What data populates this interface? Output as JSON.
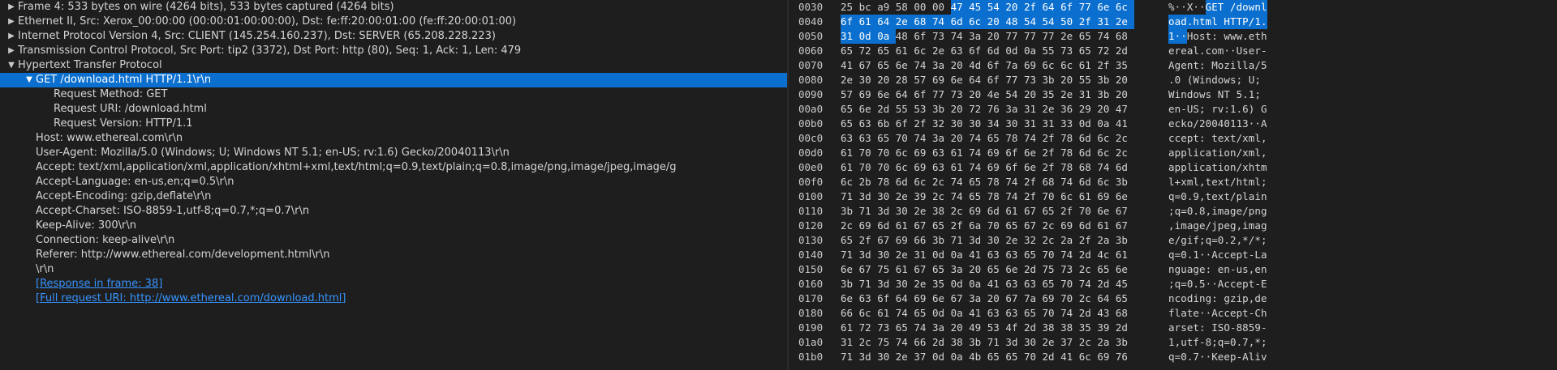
{
  "tree": [
    {
      "expander": "▶",
      "text": "Frame 4: 533 bytes on wire (4264 bits), 533 bytes captured (4264 bits)",
      "depth": 0
    },
    {
      "expander": "▶",
      "text": "Ethernet II, Src: Xerox_00:00:00 (00:00:01:00:00:00), Dst: fe:ff:20:00:01:00 (fe:ff:20:00:01:00)",
      "depth": 0
    },
    {
      "expander": "▶",
      "text": "Internet Protocol Version 4, Src: CLIENT (145.254.160.237), Dst: SERVER (65.208.228.223)",
      "depth": 0
    },
    {
      "expander": "▶",
      "text": "Transmission Control Protocol, Src Port: tip2 (3372), Dst Port: http (80), Seq: 1, Ack: 1, Len: 479",
      "depth": 0
    },
    {
      "expander": "▼",
      "text": "Hypertext Transfer Protocol",
      "depth": 0
    },
    {
      "expander": "▼",
      "text": "GET /download.html HTTP/1.1\\r\\n",
      "depth": 1,
      "selected": true
    },
    {
      "expander": "",
      "text": "Request Method: GET",
      "depth": 2
    },
    {
      "expander": "",
      "text": "Request URI: /download.html",
      "depth": 2
    },
    {
      "expander": "",
      "text": "Request Version: HTTP/1.1",
      "depth": 2
    },
    {
      "expander": "",
      "text": "Host: www.ethereal.com\\r\\n",
      "depth": 1
    },
    {
      "expander": "",
      "text": "User-Agent: Mozilla/5.0 (Windows; U; Windows NT 5.1; en-US; rv:1.6) Gecko/20040113\\r\\n",
      "depth": 1
    },
    {
      "expander": "",
      "text": "Accept: text/xml,application/xml,application/xhtml+xml,text/html;q=0.9,text/plain;q=0.8,image/png,image/jpeg,image/g",
      "depth": 1
    },
    {
      "expander": "",
      "text": "Accept-Language: en-us,en;q=0.5\\r\\n",
      "depth": 1
    },
    {
      "expander": "",
      "text": "Accept-Encoding: gzip,deflate\\r\\n",
      "depth": 1
    },
    {
      "expander": "",
      "text": "Accept-Charset: ISO-8859-1,utf-8;q=0.7,*;q=0.7\\r\\n",
      "depth": 1
    },
    {
      "expander": "",
      "text": "Keep-Alive: 300\\r\\n",
      "depth": 1
    },
    {
      "expander": "",
      "text": "Connection: keep-alive\\r\\n",
      "depth": 1
    },
    {
      "expander": "",
      "text": "Referer: http://www.ethereal.com/development.html\\r\\n",
      "depth": 1
    },
    {
      "expander": "",
      "text": "\\r\\n",
      "depth": 1
    },
    {
      "expander": "",
      "text": "[Response in frame: 38]",
      "depth": 1,
      "link": true
    },
    {
      "expander": "",
      "text": "[Full request URI: http://www.ethereal.com/download.html]",
      "depth": 1,
      "link": true
    }
  ],
  "hexdump": [
    {
      "offset": "0030",
      "hex": [
        "25",
        "bc",
        "a9",
        "58",
        "00",
        "00",
        "47",
        "45",
        "54",
        "20",
        "2f",
        "64",
        "6f",
        "77",
        "6e",
        "6c"
      ],
      "ascii": [
        "%",
        "·",
        "·",
        "X",
        "·",
        "·",
        "G",
        "E",
        "T",
        " ",
        "/",
        "d",
        "o",
        "w",
        "n",
        "l"
      ],
      "hl_from": 6
    },
    {
      "offset": "0040",
      "hex": [
        "6f",
        "61",
        "64",
        "2e",
        "68",
        "74",
        "6d",
        "6c",
        "20",
        "48",
        "54",
        "54",
        "50",
        "2f",
        "31",
        "2e"
      ],
      "ascii": [
        "o",
        "a",
        "d",
        ".",
        "h",
        "t",
        "m",
        "l",
        " ",
        "H",
        "T",
        "T",
        "P",
        "/",
        "1",
        "."
      ],
      "hl_from": 0
    },
    {
      "offset": "0050",
      "hex": [
        "31",
        "0d",
        "0a",
        "48",
        "6f",
        "73",
        "74",
        "3a",
        "20",
        "77",
        "77",
        "77",
        "2e",
        "65",
        "74",
        "68"
      ],
      "ascii": [
        "1",
        "·",
        "·",
        "H",
        "o",
        "s",
        "t",
        ":",
        " ",
        "w",
        "w",
        "w",
        ".",
        "e",
        "t",
        "h"
      ],
      "hl_to": 3
    },
    {
      "offset": "0060",
      "hex": [
        "65",
        "72",
        "65",
        "61",
        "6c",
        "2e",
        "63",
        "6f",
        "6d",
        "0d",
        "0a",
        "55",
        "73",
        "65",
        "72",
        "2d"
      ],
      "ascii": [
        "e",
        "r",
        "e",
        "a",
        "l",
        ".",
        "c",
        "o",
        "m",
        "·",
        "·",
        "U",
        "s",
        "e",
        "r",
        "-"
      ]
    },
    {
      "offset": "0070",
      "hex": [
        "41",
        "67",
        "65",
        "6e",
        "74",
        "3a",
        "20",
        "4d",
        "6f",
        "7a",
        "69",
        "6c",
        "6c",
        "61",
        "2f",
        "35"
      ],
      "ascii": [
        "A",
        "g",
        "e",
        "n",
        "t",
        ":",
        " ",
        "M",
        "o",
        "z",
        "i",
        "l",
        "l",
        "a",
        "/",
        "5"
      ]
    },
    {
      "offset": "0080",
      "hex": [
        "2e",
        "30",
        "20",
        "28",
        "57",
        "69",
        "6e",
        "64",
        "6f",
        "77",
        "73",
        "3b",
        "20",
        "55",
        "3b",
        "20"
      ],
      "ascii": [
        ".",
        "0",
        " ",
        "(",
        "W",
        "i",
        "n",
        "d",
        "o",
        "w",
        "s",
        ";",
        " ",
        "U",
        ";",
        " "
      ]
    },
    {
      "offset": "0090",
      "hex": [
        "57",
        "69",
        "6e",
        "64",
        "6f",
        "77",
        "73",
        "20",
        "4e",
        "54",
        "20",
        "35",
        "2e",
        "31",
        "3b",
        "20"
      ],
      "ascii": [
        "W",
        "i",
        "n",
        "d",
        "o",
        "w",
        "s",
        " ",
        "N",
        "T",
        " ",
        "5",
        ".",
        "1",
        ";",
        " "
      ]
    },
    {
      "offset": "00a0",
      "hex": [
        "65",
        "6e",
        "2d",
        "55",
        "53",
        "3b",
        "20",
        "72",
        "76",
        "3a",
        "31",
        "2e",
        "36",
        "29",
        "20",
        "47"
      ],
      "ascii": [
        "e",
        "n",
        "-",
        "U",
        "S",
        ";",
        " ",
        "r",
        "v",
        ":",
        "1",
        ".",
        "6",
        ")",
        " ",
        "G"
      ]
    },
    {
      "offset": "00b0",
      "hex": [
        "65",
        "63",
        "6b",
        "6f",
        "2f",
        "32",
        "30",
        "30",
        "34",
        "30",
        "31",
        "31",
        "33",
        "0d",
        "0a",
        "41"
      ],
      "ascii": [
        "e",
        "c",
        "k",
        "o",
        "/",
        "2",
        "0",
        "0",
        "4",
        "0",
        "1",
        "1",
        "3",
        "·",
        "·",
        "A"
      ]
    },
    {
      "offset": "00c0",
      "hex": [
        "63",
        "63",
        "65",
        "70",
        "74",
        "3a",
        "20",
        "74",
        "65",
        "78",
        "74",
        "2f",
        "78",
        "6d",
        "6c",
        "2c"
      ],
      "ascii": [
        "c",
        "c",
        "e",
        "p",
        "t",
        ":",
        " ",
        "t",
        "e",
        "x",
        "t",
        "/",
        "x",
        "m",
        "l",
        ","
      ]
    },
    {
      "offset": "00d0",
      "hex": [
        "61",
        "70",
        "70",
        "6c",
        "69",
        "63",
        "61",
        "74",
        "69",
        "6f",
        "6e",
        "2f",
        "78",
        "6d",
        "6c",
        "2c"
      ],
      "ascii": [
        "a",
        "p",
        "p",
        "l",
        "i",
        "c",
        "a",
        "t",
        "i",
        "o",
        "n",
        "/",
        "x",
        "m",
        "l",
        ","
      ]
    },
    {
      "offset": "00e0",
      "hex": [
        "61",
        "70",
        "70",
        "6c",
        "69",
        "63",
        "61",
        "74",
        "69",
        "6f",
        "6e",
        "2f",
        "78",
        "68",
        "74",
        "6d"
      ],
      "ascii": [
        "a",
        "p",
        "p",
        "l",
        "i",
        "c",
        "a",
        "t",
        "i",
        "o",
        "n",
        "/",
        "x",
        "h",
        "t",
        "m"
      ]
    },
    {
      "offset": "00f0",
      "hex": [
        "6c",
        "2b",
        "78",
        "6d",
        "6c",
        "2c",
        "74",
        "65",
        "78",
        "74",
        "2f",
        "68",
        "74",
        "6d",
        "6c",
        "3b"
      ],
      "ascii": [
        "l",
        "+",
        "x",
        "m",
        "l",
        ",",
        "t",
        "e",
        "x",
        "t",
        "/",
        "h",
        "t",
        "m",
        "l",
        ";"
      ]
    },
    {
      "offset": "0100",
      "hex": [
        "71",
        "3d",
        "30",
        "2e",
        "39",
        "2c",
        "74",
        "65",
        "78",
        "74",
        "2f",
        "70",
        "6c",
        "61",
        "69",
        "6e"
      ],
      "ascii": [
        "q",
        "=",
        "0",
        ".",
        "9",
        ",",
        "t",
        "e",
        "x",
        "t",
        "/",
        "p",
        "l",
        "a",
        "i",
        "n"
      ]
    },
    {
      "offset": "0110",
      "hex": [
        "3b",
        "71",
        "3d",
        "30",
        "2e",
        "38",
        "2c",
        "69",
        "6d",
        "61",
        "67",
        "65",
        "2f",
        "70",
        "6e",
        "67"
      ],
      "ascii": [
        ";",
        "q",
        "=",
        "0",
        ".",
        "8",
        ",",
        "i",
        "m",
        "a",
        "g",
        "e",
        "/",
        "p",
        "n",
        "g"
      ]
    },
    {
      "offset": "0120",
      "hex": [
        "2c",
        "69",
        "6d",
        "61",
        "67",
        "65",
        "2f",
        "6a",
        "70",
        "65",
        "67",
        "2c",
        "69",
        "6d",
        "61",
        "67"
      ],
      "ascii": [
        ",",
        "i",
        "m",
        "a",
        "g",
        "e",
        "/",
        "j",
        "p",
        "e",
        "g",
        ",",
        "i",
        "m",
        "a",
        "g"
      ]
    },
    {
      "offset": "0130",
      "hex": [
        "65",
        "2f",
        "67",
        "69",
        "66",
        "3b",
        "71",
        "3d",
        "30",
        "2e",
        "32",
        "2c",
        "2a",
        "2f",
        "2a",
        "3b"
      ],
      "ascii": [
        "e",
        "/",
        "g",
        "i",
        "f",
        ";",
        "q",
        "=",
        "0",
        ".",
        "2",
        ",",
        "*",
        "/",
        "*",
        ";"
      ]
    },
    {
      "offset": "0140",
      "hex": [
        "71",
        "3d",
        "30",
        "2e",
        "31",
        "0d",
        "0a",
        "41",
        "63",
        "63",
        "65",
        "70",
        "74",
        "2d",
        "4c",
        "61"
      ],
      "ascii": [
        "q",
        "=",
        "0",
        ".",
        "1",
        "·",
        "·",
        "A",
        "c",
        "c",
        "e",
        "p",
        "t",
        "-",
        "L",
        "a"
      ]
    },
    {
      "offset": "0150",
      "hex": [
        "6e",
        "67",
        "75",
        "61",
        "67",
        "65",
        "3a",
        "20",
        "65",
        "6e",
        "2d",
        "75",
        "73",
        "2c",
        "65",
        "6e"
      ],
      "ascii": [
        "n",
        "g",
        "u",
        "a",
        "g",
        "e",
        ":",
        " ",
        "e",
        "n",
        "-",
        "u",
        "s",
        ",",
        "e",
        "n"
      ]
    },
    {
      "offset": "0160",
      "hex": [
        "3b",
        "71",
        "3d",
        "30",
        "2e",
        "35",
        "0d",
        "0a",
        "41",
        "63",
        "63",
        "65",
        "70",
        "74",
        "2d",
        "45"
      ],
      "ascii": [
        ";",
        "q",
        "=",
        "0",
        ".",
        "5",
        "·",
        "·",
        "A",
        "c",
        "c",
        "e",
        "p",
        "t",
        "-",
        "E"
      ]
    },
    {
      "offset": "0170",
      "hex": [
        "6e",
        "63",
        "6f",
        "64",
        "69",
        "6e",
        "67",
        "3a",
        "20",
        "67",
        "7a",
        "69",
        "70",
        "2c",
        "64",
        "65"
      ],
      "ascii": [
        "n",
        "c",
        "o",
        "d",
        "i",
        "n",
        "g",
        ":",
        " ",
        "g",
        "z",
        "i",
        "p",
        ",",
        "d",
        "e"
      ]
    },
    {
      "offset": "0180",
      "hex": [
        "66",
        "6c",
        "61",
        "74",
        "65",
        "0d",
        "0a",
        "41",
        "63",
        "63",
        "65",
        "70",
        "74",
        "2d",
        "43",
        "68"
      ],
      "ascii": [
        "f",
        "l",
        "a",
        "t",
        "e",
        "·",
        "·",
        "A",
        "c",
        "c",
        "e",
        "p",
        "t",
        "-",
        "C",
        "h"
      ]
    },
    {
      "offset": "0190",
      "hex": [
        "61",
        "72",
        "73",
        "65",
        "74",
        "3a",
        "20",
        "49",
        "53",
        "4f",
        "2d",
        "38",
        "38",
        "35",
        "39",
        "2d"
      ],
      "ascii": [
        "a",
        "r",
        "s",
        "e",
        "t",
        ":",
        " ",
        "I",
        "S",
        "O",
        "-",
        "8",
        "8",
        "5",
        "9",
        "-"
      ]
    },
    {
      "offset": "01a0",
      "hex": [
        "31",
        "2c",
        "75",
        "74",
        "66",
        "2d",
        "38",
        "3b",
        "71",
        "3d",
        "30",
        "2e",
        "37",
        "2c",
        "2a",
        "3b"
      ],
      "ascii": [
        "1",
        ",",
        "u",
        "t",
        "f",
        "-",
        "8",
        ";",
        "q",
        "=",
        "0",
        ".",
        "7",
        ",",
        "*",
        ";"
      ]
    },
    {
      "offset": "01b0",
      "hex": [
        "71",
        "3d",
        "30",
        "2e",
        "37",
        "0d",
        "0a",
        "4b",
        "65",
        "65",
        "70",
        "2d",
        "41",
        "6c",
        "69",
        "76"
      ],
      "ascii": [
        "q",
        "=",
        "0",
        ".",
        "7",
        "·",
        "·",
        "K",
        "e",
        "e",
        "p",
        "-",
        "A",
        "l",
        "i",
        "v"
      ]
    }
  ],
  "colors": {
    "selection": "#0a6fce",
    "link": "#3794ff",
    "background": "#1e1e1e"
  }
}
